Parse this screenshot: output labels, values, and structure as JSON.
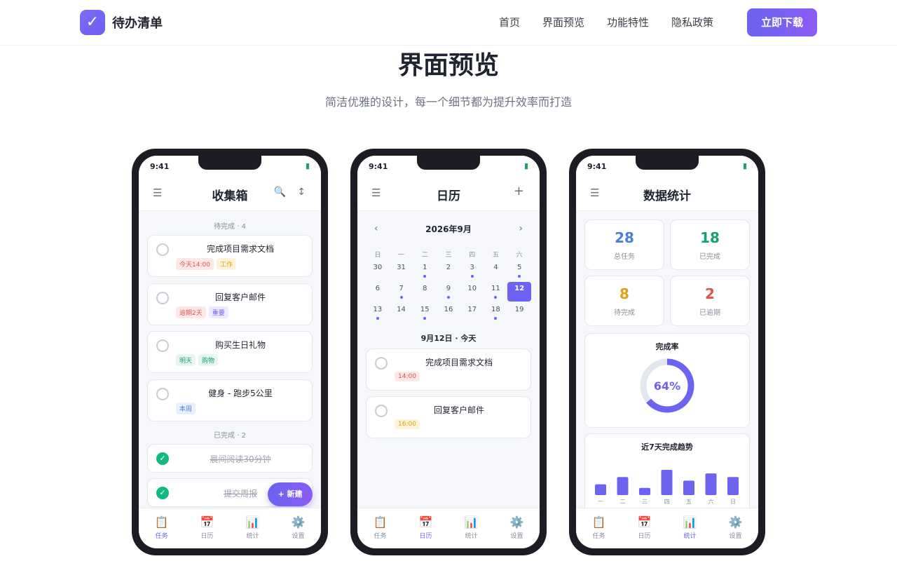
{
  "nav": {
    "brand": "待办清单",
    "links": [
      "首页",
      "界面预览",
      "功能特性",
      "隐私政策"
    ],
    "download": "立即下载"
  },
  "hero": {
    "title": "界面预览",
    "subtitle": "简洁优雅的设计，每一个细节都为提升效率而打造"
  },
  "status": {
    "time": "9:41"
  },
  "tabs": [
    "任务",
    "日历",
    "统计",
    "设置"
  ],
  "inbox": {
    "title": "收集箱",
    "pending_section": "待完成 · 4",
    "done_section": "已完成 · 2",
    "tasks": [
      {
        "title": "完成项目需求文档",
        "tags": [
          {
            "text": "今天14:00",
            "bg": "#fde8e8",
            "fg": "#e05252"
          },
          {
            "text": "工作",
            "bg": "#fdf3d8",
            "fg": "#d9a514"
          }
        ]
      },
      {
        "title": "回复客户邮件",
        "tags": [
          {
            "text": "逾期2天",
            "bg": "#fde8e8",
            "fg": "#e05252"
          },
          {
            "text": "重要",
            "bg": "#ede9fe",
            "fg": "#7c5cf0"
          }
        ]
      },
      {
        "title": "购买生日礼物",
        "tags": [
          {
            "text": "明天",
            "bg": "#e6f7ef",
            "fg": "#18a06b"
          },
          {
            "text": "购物",
            "bg": "#e6f7ef",
            "fg": "#18a06b"
          }
        ]
      },
      {
        "title": "健身 - 跑步5公里",
        "tags": [
          {
            "text": "本周",
            "bg": "#e8f0fd",
            "fg": "#4a7fe0"
          }
        ]
      }
    ],
    "done": [
      "晨间阅读30分钟",
      "提交周报"
    ],
    "fab": "+ 新建"
  },
  "calendar": {
    "title": "日历",
    "month": "2026年9月",
    "weekdays": [
      "日",
      "一",
      "二",
      "三",
      "四",
      "五",
      "六"
    ],
    "days": [
      {
        "d": "30",
        "dot": false
      },
      {
        "d": "31",
        "dot": false
      },
      {
        "d": "1",
        "dot": true
      },
      {
        "d": "2",
        "dot": false
      },
      {
        "d": "3",
        "dot": true
      },
      {
        "d": "4",
        "dot": false
      },
      {
        "d": "5",
        "dot": true
      },
      {
        "d": "6",
        "dot": false
      },
      {
        "d": "7",
        "dot": true
      },
      {
        "d": "8",
        "dot": false
      },
      {
        "d": "9",
        "dot": true
      },
      {
        "d": "10",
        "dot": false
      },
      {
        "d": "11",
        "dot": true
      },
      {
        "d": "12",
        "dot": false,
        "sel": true
      },
      {
        "d": "13",
        "dot": true
      },
      {
        "d": "14",
        "dot": false
      },
      {
        "d": "15",
        "dot": true
      },
      {
        "d": "16",
        "dot": false
      },
      {
        "d": "17",
        "dot": false
      },
      {
        "d": "18",
        "dot": true
      },
      {
        "d": "19",
        "dot": false
      }
    ],
    "day_label": "9月12日 · 今天",
    "events": [
      {
        "title": "完成项目需求文档",
        "time": "14:00",
        "bg": "#fde8e8",
        "fg": "#e05252"
      },
      {
        "title": "回复客户邮件",
        "time": "16:00",
        "bg": "#fdf3d8",
        "fg": "#d9a514"
      }
    ]
  },
  "stats": {
    "title": "数据统计",
    "cards": [
      {
        "n": "28",
        "l": "总任务",
        "color": "#4a7fe0"
      },
      {
        "n": "18",
        "l": "已完成",
        "color": "#18a06b"
      },
      {
        "n": "8",
        "l": "待完成",
        "color": "#e0a214"
      },
      {
        "n": "2",
        "l": "已逾期",
        "color": "#e05252"
      }
    ],
    "rate_title": "完成率",
    "rate": "64%",
    "rate_value": 64,
    "trend_title": "近7天完成趋势"
  },
  "chart_data": {
    "type": "bar",
    "categories": [
      "一",
      "二",
      "三",
      "四",
      "五",
      "六",
      "日"
    ],
    "values": [
      3,
      5,
      2,
      7,
      4,
      6,
      5
    ],
    "title": "近7天完成趋势"
  }
}
